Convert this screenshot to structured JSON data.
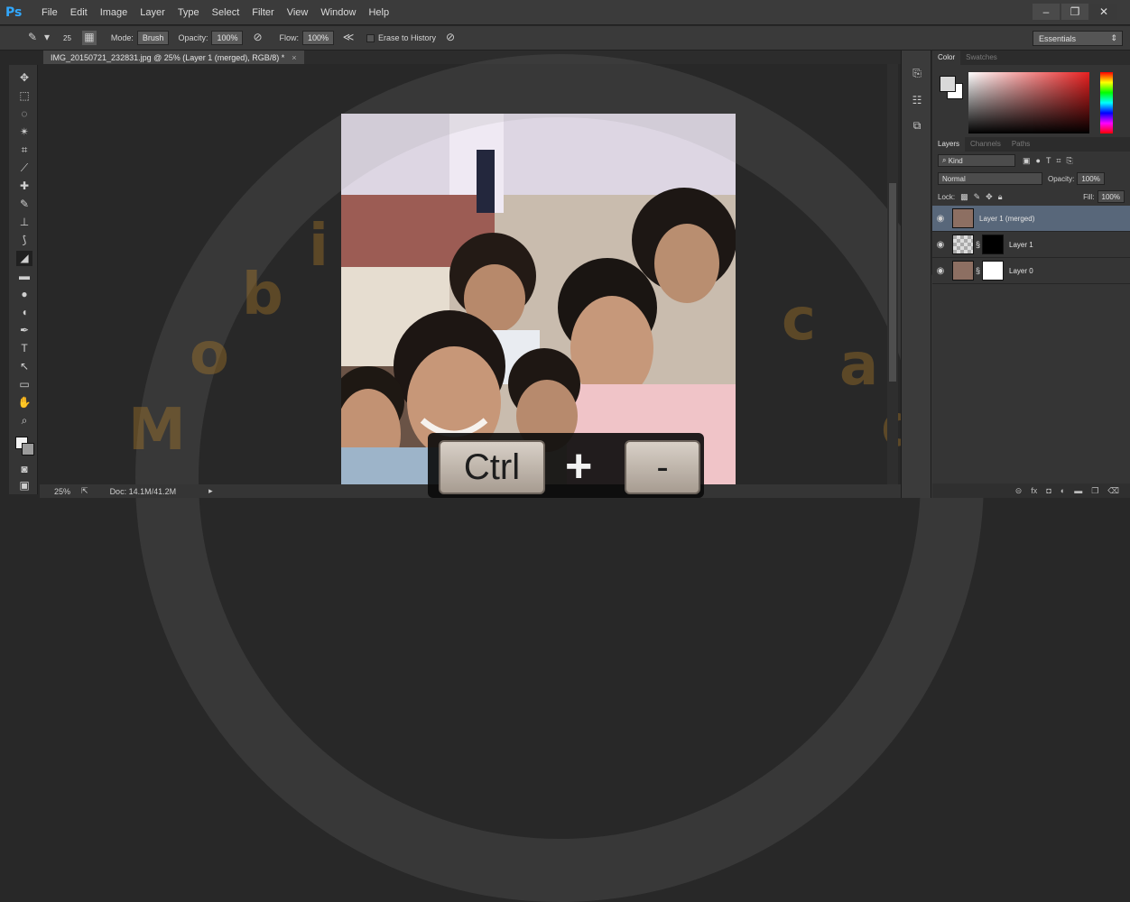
{
  "app": {
    "logo": "Ps"
  },
  "menu": [
    "File",
    "Edit",
    "Image",
    "Layer",
    "Type",
    "Select",
    "Filter",
    "View",
    "Window",
    "Help"
  ],
  "options": {
    "brush_size": "25",
    "mode_label": "Mode:",
    "mode_value": "Brush",
    "opacity_label": "Opacity:",
    "opacity_value": "100%",
    "flow_label": "Flow:",
    "flow_value": "100%",
    "erase_history": "Erase to History",
    "workspace": "Essentials"
  },
  "document": {
    "tab_title": "IMG_20150721_232831.jpg @ 25% (Layer 1 (merged), RGB/8) *",
    "zoom": "25%",
    "doc_info": "Doc: 14.1M/41.2M"
  },
  "color_panel": {
    "tabs": [
      "Color",
      "Swatches"
    ]
  },
  "layers_panel": {
    "tabs": [
      "Layers",
      "Channels",
      "Paths"
    ],
    "kind": "Kind",
    "blend_mode": "Normal",
    "opacity_label": "Opacity:",
    "opacity_value": "100%",
    "lock_label": "Lock:",
    "fill_label": "Fill:",
    "fill_value": "100%",
    "layers": [
      {
        "name": "Layer 1 (merged)",
        "selected": true
      },
      {
        "name": "Layer 1",
        "selected": false
      },
      {
        "name": "Layer 0",
        "selected": false
      }
    ]
  },
  "overlay": {
    "key1": "Ctrl",
    "plus": "+",
    "key2": "-"
  },
  "colors": {
    "accent": "#31a8ff",
    "selection": "#58677a"
  }
}
